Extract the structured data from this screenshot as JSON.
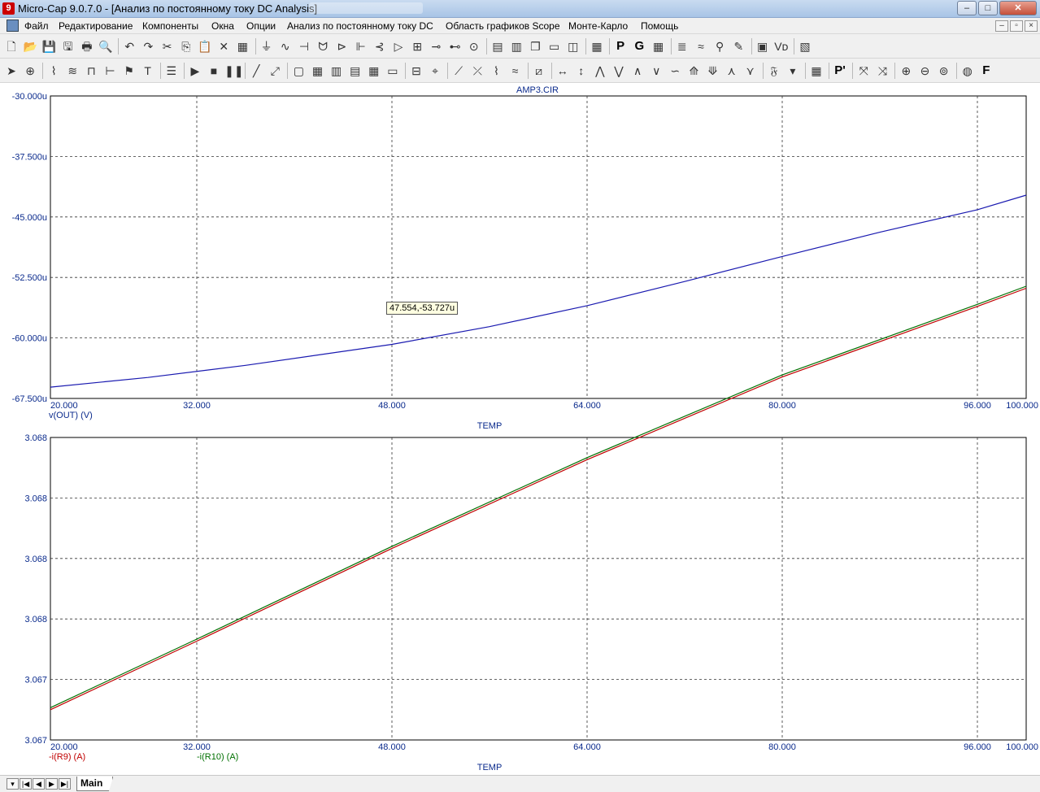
{
  "window": {
    "title": "Micro-Cap 9.0.7.0 - [Анализ по постоянному току DC Analysis]",
    "controls": {
      "minimize": "–",
      "maximize": "□",
      "close": "✕"
    }
  },
  "menubar": {
    "items": [
      {
        "id": "file",
        "label": "Файл"
      },
      {
        "id": "edit",
        "label": "Редактирование"
      },
      {
        "id": "components",
        "label": "Компоненты"
      },
      {
        "id": "windows",
        "label": "Окна"
      },
      {
        "id": "options",
        "label": "Опции"
      },
      {
        "id": "dc",
        "label": "Анализ по постоянному току DC"
      },
      {
        "id": "scope",
        "label": "Область графиков Scope"
      },
      {
        "id": "montecarlo",
        "label": "Монте-Карло"
      },
      {
        "id": "help",
        "label": "Помощь"
      }
    ],
    "mdi": {
      "minimize": "–",
      "restore": "▫",
      "close": "×"
    }
  },
  "toolbar1": {
    "icons": [
      "new-file-icon",
      "open-file-icon",
      "save-icon",
      "save-all-icon",
      "print-icon",
      "print-preview-icon",
      "undo-icon",
      "redo-icon",
      "cut-icon",
      "copy-icon",
      "paste-icon",
      "delete-icon",
      "select-all-icon",
      "ground-icon",
      "resistor-icon",
      "capacitor-icon",
      "inductor-icon",
      "diode-icon",
      "battery-icon",
      "transistor-icon",
      "opamp-icon",
      "transformer-icon",
      "npn-icon",
      "pnp-icon",
      "source-icon",
      "tile-horizontal-icon",
      "tile-vertical-icon",
      "cascade-icon",
      "window-icon",
      "split-window-icon",
      "calculator-icon",
      "P",
      "G",
      "grid-icon",
      "component-list-icon",
      "waveform-icon",
      "probe-icon",
      "pen-icon",
      "plot-properties-icon",
      "vd-icon",
      "image-icon"
    ]
  },
  "toolbar2": {
    "icons": [
      "select-arrow-icon",
      "component-mode-icon",
      "wire-icon",
      "bus-icon",
      "node-icon",
      "pin-icon",
      "flag-icon",
      "text-icon",
      "properties-icon",
      "run-icon",
      "stop-icon",
      "pause-icon",
      "line-icon",
      "diagonal-line-icon",
      "box-icon",
      "table-icon",
      "column-icon",
      "row-icon",
      "grid2-icon",
      "frame-icon",
      "horizontal-line-icon",
      "cursor-icon",
      "slope-icon",
      "intersect-icon",
      "marker-icon",
      "curve-icon",
      "scale-icon",
      "horizontal-cursor-icon",
      "vertical-cursor-icon",
      "peak-icon",
      "valley-icon",
      "high-icon",
      "low-icon",
      "inflection-icon",
      "global-high-icon",
      "global-low-icon",
      "top-icon",
      "bottom-icon",
      "fourier-icon",
      "dropdown-icon",
      "table-view-icon",
      "P'",
      "x-cursor-icon",
      "y-cursor-icon",
      "zoom-in-icon",
      "zoom-out-icon",
      "zoom-fit-icon",
      "palette-icon",
      "F"
    ]
  },
  "plot": {
    "title": "AMP3.CIR",
    "xlabel": "TEMP",
    "x_ticks": [
      "20.000",
      "32.000",
      "48.000",
      "64.000",
      "80.000",
      "96.000",
      "100.000"
    ],
    "cursor_readout": "47.554,-53.727u",
    "top_y_ticks": [
      "-30.000u",
      "-37.500u",
      "-45.000u",
      "-52.500u",
      "-60.000u",
      "-67.500u"
    ],
    "bottom_y_ticks": [
      "3.068",
      "3.068",
      "3.068",
      "3.068",
      "3.067",
      "3.067"
    ],
    "top_legend": "v(OUT) (V)",
    "bottom_legend": [
      "-i(R9) (A)",
      "-i(R10) (A)"
    ],
    "colors": {
      "axis_text": "#0a2a8c",
      "vout": "#1a1ab0",
      "r9": "#c00000",
      "r10": "#007000",
      "grid": "#333333"
    }
  },
  "chart_data": [
    {
      "type": "line",
      "title": "AMP3.CIR",
      "xlabel": "TEMP",
      "ylabel": "",
      "xlim": [
        20,
        100
      ],
      "ylim": [
        -67.5,
        -30.0
      ],
      "y_unit": "u",
      "grid": true,
      "series": [
        {
          "name": "v(OUT) (V)",
          "x": [
            20,
            28,
            36,
            48,
            56,
            64,
            72,
            80,
            88,
            96,
            100
          ],
          "values": [
            -66.1,
            -64.9,
            -63.4,
            -60.8,
            -58.6,
            -56.0,
            -53.0,
            -49.9,
            -46.9,
            -44.1,
            -42.3
          ]
        }
      ]
    },
    {
      "type": "line",
      "xlabel": "TEMP",
      "ylabel": "",
      "xlim": [
        20,
        100
      ],
      "ylim": [
        3.0665,
        3.068
      ],
      "grid": true,
      "series": [
        {
          "name": "-i(R9) (A)",
          "x": [
            20,
            32,
            48,
            64,
            80,
            96,
            100
          ],
          "values": [
            3.06665,
            3.06699,
            3.06745,
            3.06789,
            3.0683,
            3.06865,
            3.06874
          ]
        },
        {
          "name": "-i(R10) (A)",
          "x": [
            20,
            32,
            48,
            64,
            80,
            96,
            100
          ],
          "values": [
            3.06666,
            3.067,
            3.06746,
            3.0679,
            3.06831,
            3.06866,
            3.06875
          ]
        }
      ]
    }
  ],
  "statusbar": {
    "nav": [
      "▾",
      "|◀",
      "◀",
      "▶",
      "▶|"
    ],
    "sheet_tab": "Main"
  }
}
